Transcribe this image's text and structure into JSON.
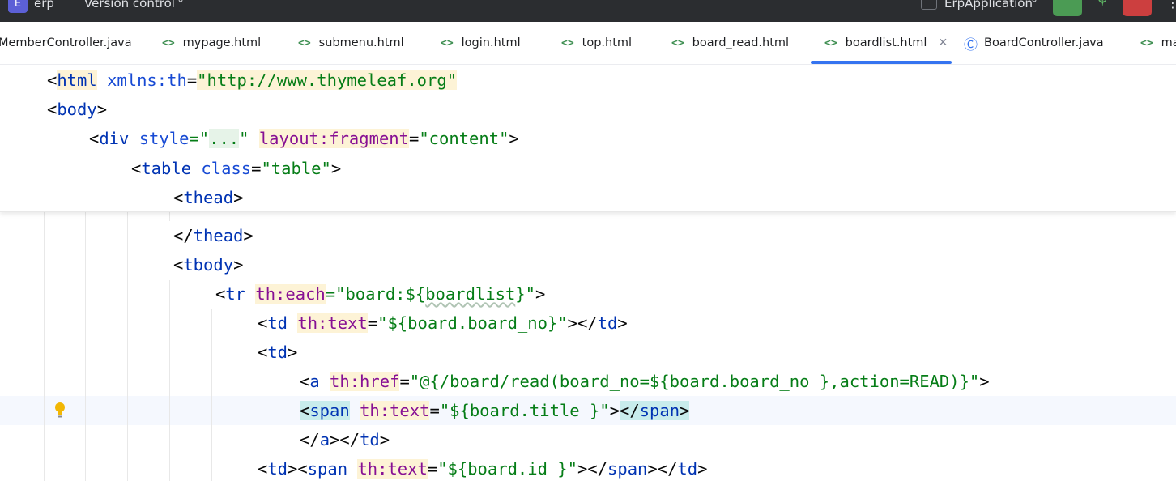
{
  "titlebar": {
    "project_badge": "E",
    "project_name": "erp",
    "version_control": "Version control",
    "run_config": "ErpApplication"
  },
  "tabs": [
    {
      "label": "MemberController.java",
      "icon": "java-class-icon"
    },
    {
      "label": "mypage.html",
      "icon": "html-icon"
    },
    {
      "label": "submenu.html",
      "icon": "html-icon"
    },
    {
      "label": "login.html",
      "icon": "html-icon"
    },
    {
      "label": "top.html",
      "icon": "html-icon"
    },
    {
      "label": "board_read.html",
      "icon": "html-icon"
    },
    {
      "label": "boardlist.html",
      "icon": "html-icon",
      "active": true
    },
    {
      "label": "BoardController.java",
      "icon": "java-class-icon"
    },
    {
      "label": "ma",
      "icon": "html-icon"
    }
  ],
  "colors": {
    "accent": "#3574f0",
    "tag": "#0033b3",
    "string": "#067d17",
    "namespace_attr": "#871094"
  },
  "editor": {
    "sticky_lines": [
      [
        "<",
        "html",
        " ",
        "xmlns:th",
        "=",
        "\"http://www.thymeleaf.org\""
      ],
      [
        "<",
        "body",
        ">"
      ],
      [
        "<",
        "div",
        " ",
        "style",
        "=\"",
        "...",
        "\"",
        " ",
        "layout:fragment",
        "=",
        "\"content\"",
        ">"
      ],
      [
        "<",
        "table",
        " ",
        "class",
        "=",
        "\"table\"",
        ">"
      ],
      [
        "<",
        "thead",
        ">"
      ]
    ],
    "lines": [
      [
        "</",
        "thead",
        ">"
      ],
      [
        "<",
        "tbody",
        ">"
      ],
      [
        "<",
        "tr",
        " ",
        "th:each",
        "=\"board:${",
        "boardlist",
        "}\"",
        ">"
      ],
      [
        "<",
        "td",
        " ",
        "th:text",
        "=",
        "\"${board.board_no}\"",
        "></",
        "td",
        ">"
      ],
      [
        "<",
        "td",
        ">"
      ],
      [
        "<",
        "a",
        " ",
        "th:href",
        "=",
        "\"@{/board/read(board_no=${board.board_no },action=READ)}\"",
        ">"
      ],
      [
        "<",
        "span",
        " ",
        "th:text",
        "=",
        "\"${board.title }\"",
        ">",
        "</",
        "span",
        ">"
      ],
      [
        "</",
        "a",
        "></",
        "td",
        ">"
      ],
      [
        "<",
        "td",
        "><",
        "span",
        " ",
        "th:text",
        "=",
        "\"${board.id }\"",
        "></",
        "span",
        "></",
        "td",
        ">"
      ]
    ]
  }
}
